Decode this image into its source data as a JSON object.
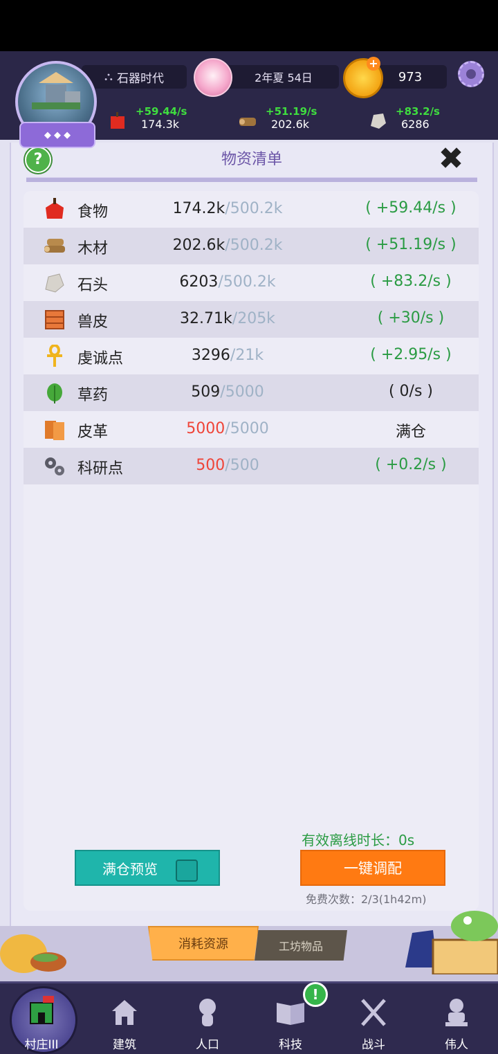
{
  "hud": {
    "era": "石器时代",
    "date": "2年夏 54日",
    "coins": "973",
    "resources": [
      {
        "name": "food",
        "rate": "+59.44/s",
        "amount": "174.3k"
      },
      {
        "name": "wood",
        "rate": "+51.19/s",
        "amount": "202.6k"
      },
      {
        "name": "stone",
        "rate": "+83.2/s",
        "amount": "6286"
      }
    ]
  },
  "panel": {
    "title": "物资清单",
    "help": "?",
    "close": "✖"
  },
  "rows": [
    {
      "icon": "apple-icon",
      "name": "食物",
      "current": "174.2k",
      "cap": "/500.2k",
      "rate": "( +59.44/s )",
      "full": false
    },
    {
      "icon": "wood-icon",
      "name": "木材",
      "current": "202.6k",
      "cap": "/500.2k",
      "rate": "( +51.19/s )",
      "full": false
    },
    {
      "icon": "stone-icon",
      "name": "石头",
      "current": "6203",
      "cap": "/500.2k",
      "rate": "( +83.2/s )",
      "full": false
    },
    {
      "icon": "hide-icon",
      "name": "兽皮",
      "current": "32.71k",
      "cap": "/205k",
      "rate": "( +30/s )",
      "full": false
    },
    {
      "icon": "ankh-icon",
      "name": "虔诚点",
      "current": "3296",
      "cap": "/21k",
      "rate": "( +2.95/s )",
      "full": false
    },
    {
      "icon": "herb-icon",
      "name": "草药",
      "current": "509",
      "cap": "/5000",
      "rate": "( 0/s )",
      "full": false
    },
    {
      "icon": "leather-icon",
      "name": "皮革",
      "current": "5000",
      "cap": "/5000",
      "rate": "满仓",
      "full": true
    },
    {
      "icon": "gears-icon",
      "name": "科研点",
      "current": "500",
      "cap": "/500",
      "rate": "( +0.2/s )",
      "full": true
    }
  ],
  "footer": {
    "offline": "有效离线时长：0s",
    "preview_label": "满仓预览",
    "dispatch_label": "一键调配",
    "free_times": "免费次数：2/3(1h42m)"
  },
  "tabs": {
    "consume": "消耗资源",
    "workshop": "工坊物品"
  },
  "nav": [
    {
      "label": "村庄III",
      "icon": "village-icon"
    },
    {
      "label": "建筑",
      "icon": "house-icon"
    },
    {
      "label": "人口",
      "icon": "person-icon"
    },
    {
      "label": "科技",
      "icon": "book-icon"
    },
    {
      "label": "战斗",
      "icon": "swords-icon"
    },
    {
      "label": "伟人",
      "icon": "bust-icon"
    }
  ],
  "nav_badge": "!",
  "colors": {
    "rate_green": "#2a9b43",
    "full_red": "#ef4438",
    "accent_purple": "#6b55a7",
    "teal_button": "#1fb5ab",
    "orange_button": "#ff7a12"
  }
}
